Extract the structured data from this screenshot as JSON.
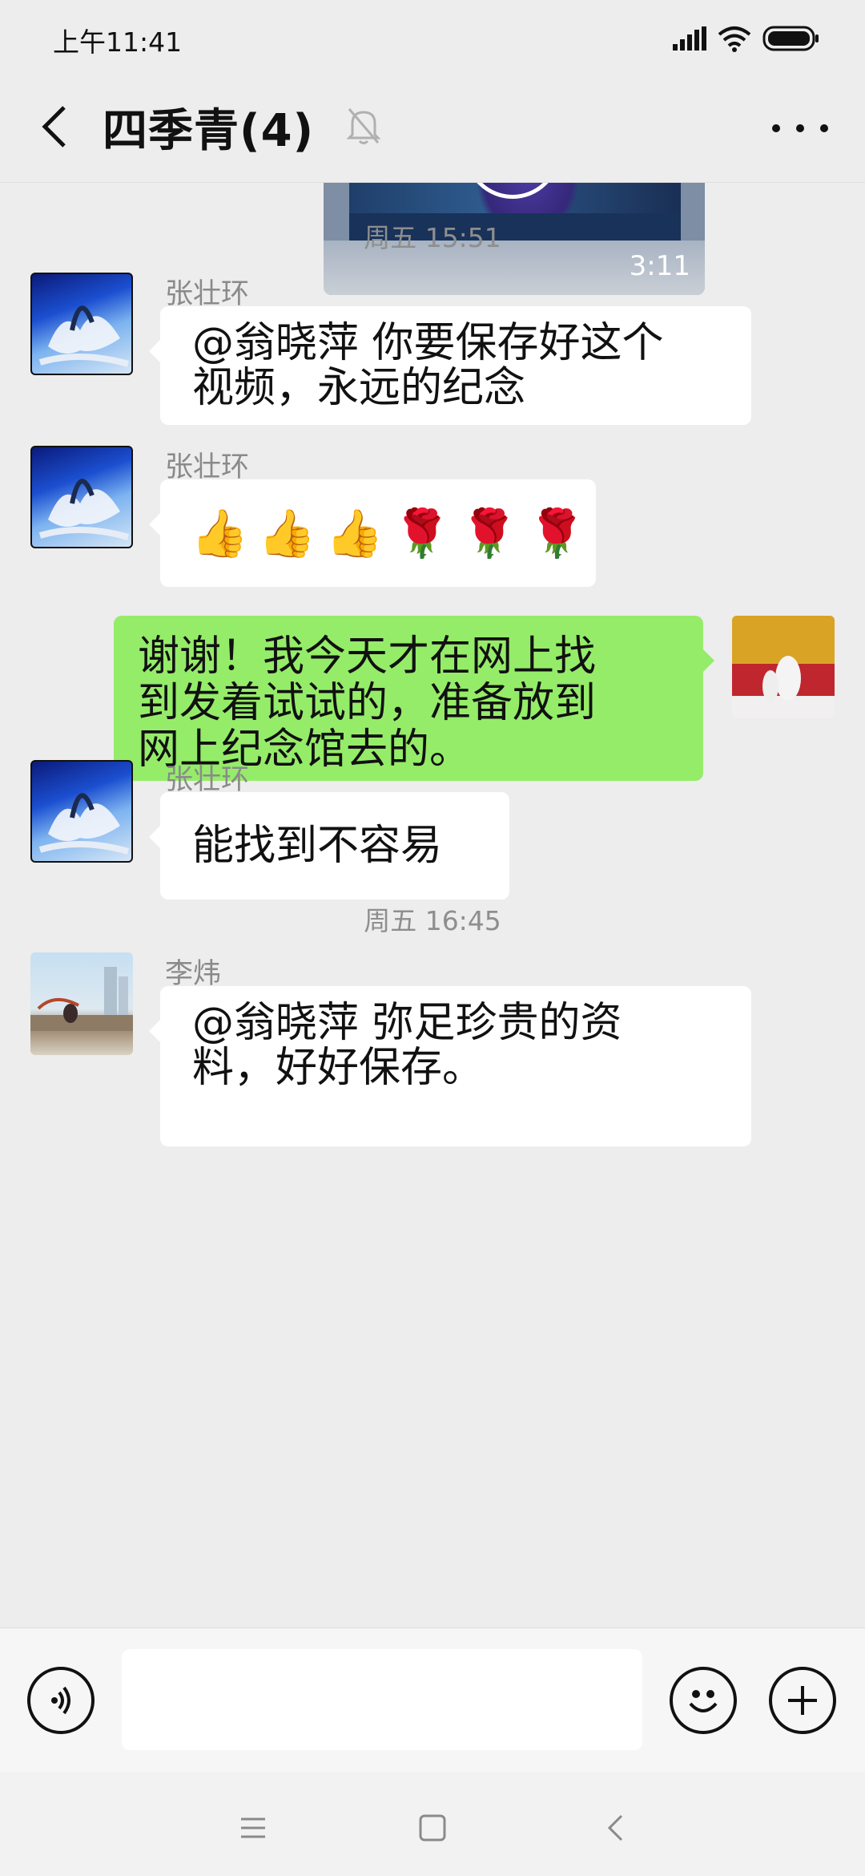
{
  "status_bar": {
    "time": "上午11:41"
  },
  "header": {
    "title": "四季青(4)"
  },
  "video": {
    "duration": "3:11"
  },
  "timestamps": [
    "周五 15:51",
    "周五 16:45"
  ],
  "messages": [
    {
      "sender": "张壮环",
      "text_lines": [
        "@翁晓萍  你要保存好这个",
        "视频，永远的纪念"
      ]
    },
    {
      "sender": "张壮环",
      "emojis": [
        "👍",
        "👍",
        "👍",
        "🌹",
        "🌹",
        "🌹"
      ]
    },
    {
      "sender": "",
      "text_lines": [
        "谢谢！我今天才在网上找",
        "到发着试试的，准备放到",
        "网上纪念馆去的。"
      ]
    },
    {
      "sender": "张壮环",
      "text_lines": [
        "能找到不容易"
      ]
    },
    {
      "sender": "李炜",
      "text_lines": [
        "@翁晓萍    弥足珍贵的资",
        "料，好好保存。"
      ]
    }
  ],
  "input": {
    "placeholder": ""
  },
  "icons": {
    "back": "back-arrow-icon",
    "mute": "bell-off-icon",
    "more": "more-dots-icon",
    "voice": "voice-icon",
    "emoji": "smiley-icon",
    "add": "plus-icon"
  },
  "colors": {
    "self_bubble": "#95ec69",
    "other_bubble": "#ffffff",
    "background": "#ededed"
  }
}
